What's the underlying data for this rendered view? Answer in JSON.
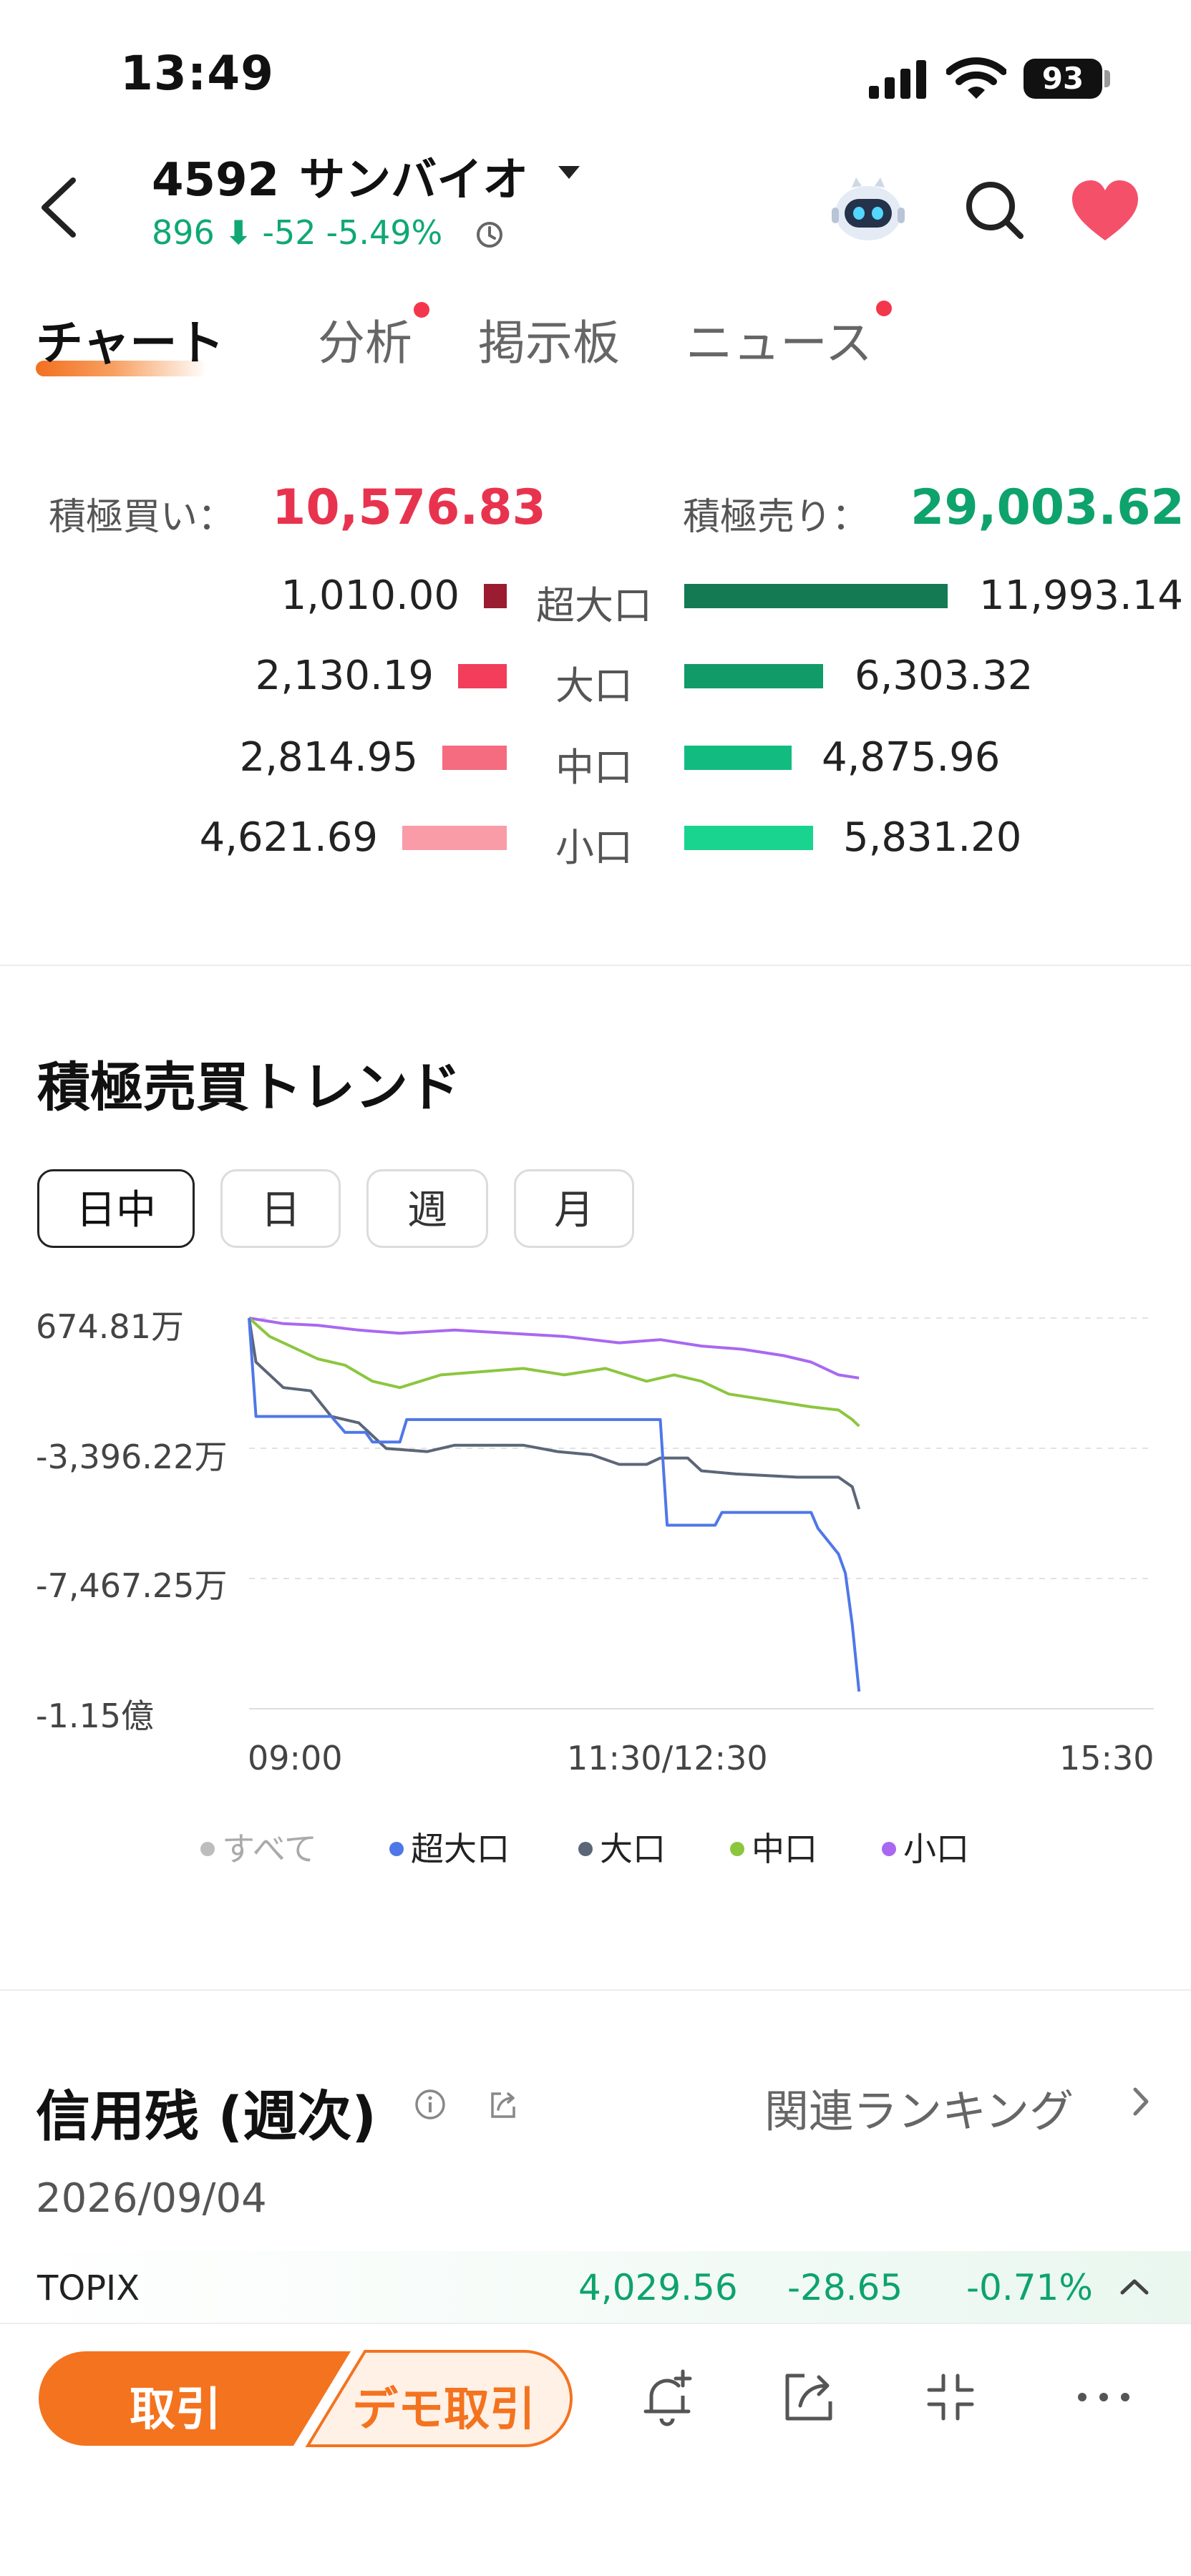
{
  "status_bar": {
    "time": "13:49",
    "battery": "93"
  },
  "header": {
    "code": "4592",
    "name": "サンバイオ",
    "price": "896",
    "change": "-52",
    "change_pct": "-5.49%",
    "icons": [
      "back-icon",
      "chevron-down-icon",
      "clock-icon",
      "robot-assistant-icon",
      "search-icon",
      "heart-icon"
    ]
  },
  "tabs": [
    {
      "label": "チャート",
      "active": true
    },
    {
      "label": "分析",
      "badge": true
    },
    {
      "label": "掲示板"
    },
    {
      "label": "ニュース",
      "badge": true
    }
  ],
  "flow": {
    "buy_label": "積極買い：",
    "buy_total": "10,576.83",
    "sell_label": "積極売り：",
    "sell_total": "29,003.62",
    "rows": [
      {
        "category": "超大口",
        "buy": "1,010.00",
        "sell": "11,993.14",
        "buy_color": "#9b1b30",
        "sell_color": "#137a54"
      },
      {
        "category": "大口",
        "buy": "2,130.19",
        "sell": "6,303.32",
        "buy_color": "#f23e5a",
        "sell_color": "#119b69"
      },
      {
        "category": "中口",
        "buy": "2,814.95",
        "sell": "4,875.96",
        "buy_color": "#f56b80",
        "sell_color": "#12bc80"
      },
      {
        "category": "小口",
        "buy": "4,621.69",
        "sell": "5,831.20",
        "buy_color": "#f99ca8",
        "sell_color": "#19d48f"
      }
    ]
  },
  "trend": {
    "title": "積極売買トレンド",
    "periods": [
      "日中",
      "日",
      "週",
      "月"
    ],
    "active_period": "日中"
  },
  "chart_data": {
    "type": "line",
    "y_ticks": [
      "674.81万",
      "-3,396.22万",
      "-7,467.25万",
      "-1.15億"
    ],
    "ylim": [
      -11538,
      675
    ],
    "x_ticks": [
      "09:00",
      "11:30/12:30",
      "15:30"
    ],
    "grid": true,
    "legend_position": "bottom",
    "x_unit_note": "",
    "series": [
      {
        "name": "超大口",
        "color": "#4f77e8",
        "points": [
          [
            0,
            675
          ],
          [
            1,
            -2400
          ],
          [
            12,
            -2400
          ],
          [
            14,
            -2900
          ],
          [
            17,
            -2900
          ],
          [
            18,
            -3200
          ],
          [
            22,
            -3200
          ],
          [
            23,
            -2500
          ],
          [
            60,
            -2500
          ],
          [
            61,
            -5800
          ],
          [
            68,
            -5800
          ],
          [
            69,
            -5400
          ],
          [
            82,
            -5400
          ],
          [
            83,
            -5900
          ],
          [
            86,
            -6700
          ],
          [
            87,
            -7300
          ],
          [
            88,
            -8900
          ],
          [
            89,
            -11000
          ]
        ]
      },
      {
        "name": "大口",
        "color": "#5b6677",
        "points": [
          [
            0,
            675
          ],
          [
            1,
            -700
          ],
          [
            5,
            -1500
          ],
          [
            9,
            -1600
          ],
          [
            12,
            -2400
          ],
          [
            16,
            -2600
          ],
          [
            20,
            -3400
          ],
          [
            26,
            -3500
          ],
          [
            30,
            -3300
          ],
          [
            40,
            -3300
          ],
          [
            45,
            -3500
          ],
          [
            50,
            -3600
          ],
          [
            54,
            -3900
          ],
          [
            58,
            -3900
          ],
          [
            60,
            -3700
          ],
          [
            64,
            -3700
          ],
          [
            66,
            -4100
          ],
          [
            71,
            -4200
          ],
          [
            80,
            -4300
          ],
          [
            86,
            -4300
          ],
          [
            88,
            -4600
          ],
          [
            89,
            -5300
          ]
        ]
      },
      {
        "name": "中口",
        "color": "#8cc63f",
        "points": [
          [
            0,
            675
          ],
          [
            3,
            100
          ],
          [
            6,
            -200
          ],
          [
            10,
            -600
          ],
          [
            14,
            -800
          ],
          [
            18,
            -1300
          ],
          [
            22,
            -1500
          ],
          [
            28,
            -1100
          ],
          [
            34,
            -1000
          ],
          [
            40,
            -900
          ],
          [
            46,
            -1100
          ],
          [
            52,
            -900
          ],
          [
            58,
            -1300
          ],
          [
            62,
            -1100
          ],
          [
            66,
            -1300
          ],
          [
            70,
            -1700
          ],
          [
            76,
            -1900
          ],
          [
            82,
            -2100
          ],
          [
            86,
            -2200
          ],
          [
            88,
            -2500
          ],
          [
            89,
            -2700
          ]
        ]
      },
      {
        "name": "小口",
        "color": "#a968f0",
        "points": [
          [
            0,
            675
          ],
          [
            5,
            500
          ],
          [
            10,
            450
          ],
          [
            16,
            300
          ],
          [
            22,
            200
          ],
          [
            30,
            300
          ],
          [
            38,
            200
          ],
          [
            46,
            100
          ],
          [
            54,
            -100
          ],
          [
            60,
            0
          ],
          [
            66,
            -200
          ],
          [
            72,
            -300
          ],
          [
            78,
            -500
          ],
          [
            82,
            -700
          ],
          [
            86,
            -1100
          ],
          [
            89,
            -1200
          ]
        ]
      }
    ],
    "legend": [
      {
        "name": "すべて",
        "color": "#bdbdbd",
        "muted": true
      },
      {
        "name": "超大口",
        "color": "#4f77e8"
      },
      {
        "name": "大口",
        "color": "#5b6677"
      },
      {
        "name": "中口",
        "color": "#8cc63f"
      },
      {
        "name": "小口",
        "color": "#a968f0"
      }
    ]
  },
  "credit": {
    "title": "信用残 (週次)",
    "ranking_link": "関連ランキング",
    "date": "2026/09/04"
  },
  "index_ticker": {
    "name": "TOPIX",
    "value": "4,029.56",
    "change": "-28.65",
    "change_pct": "-0.71%"
  },
  "toolbar": {
    "trade_label": "取引",
    "demo_label": "デモ取引",
    "icons": [
      "bell-plus-icon",
      "share-icon",
      "collapse-icon",
      "more-icon"
    ]
  }
}
